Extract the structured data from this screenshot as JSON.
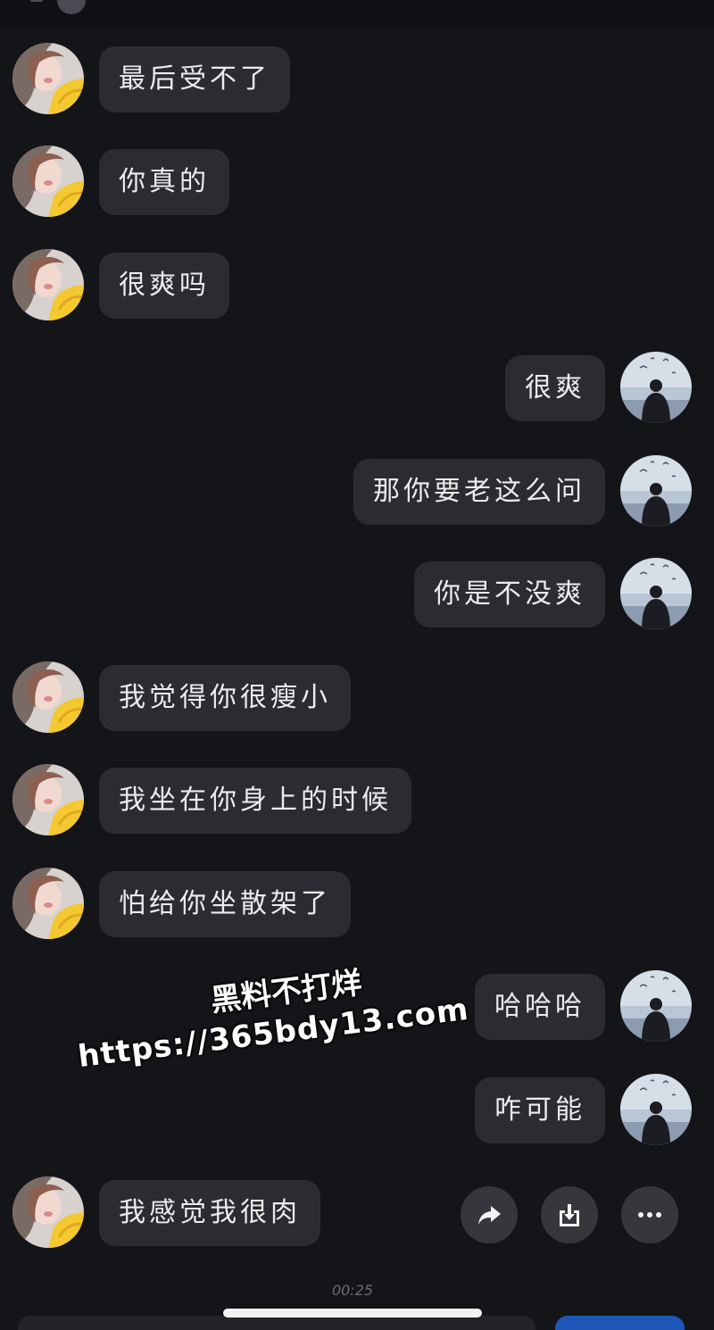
{
  "messages": [
    {
      "side": "left",
      "text": "最后受不了"
    },
    {
      "side": "left",
      "text": "你真的"
    },
    {
      "side": "left",
      "text": "很爽吗"
    },
    {
      "side": "right",
      "text": "很爽"
    },
    {
      "side": "right",
      "text": "那你要老这么问"
    },
    {
      "side": "right",
      "text": "你是不没爽"
    },
    {
      "side": "left",
      "text": "我觉得你很瘦小"
    },
    {
      "side": "left",
      "text": "我坐在你身上的时候"
    },
    {
      "side": "left",
      "text": "怕给你坐散架了"
    },
    {
      "side": "right",
      "text": "哈哈哈"
    },
    {
      "side": "right",
      "text": "咋可能"
    },
    {
      "side": "left",
      "text": "我感觉我很肉"
    }
  ],
  "actions": [
    {
      "icon": "share-arrow-icon"
    },
    {
      "icon": "download-icon"
    },
    {
      "icon": "more-dots-icon"
    }
  ],
  "watermark": {
    "line1": "黑料不打烊",
    "line2": "https://365bdy13.com"
  },
  "video_timer": "00:25",
  "colors": {
    "background": "#141518",
    "bubble": "#2b2c31",
    "text": "#ececee"
  }
}
